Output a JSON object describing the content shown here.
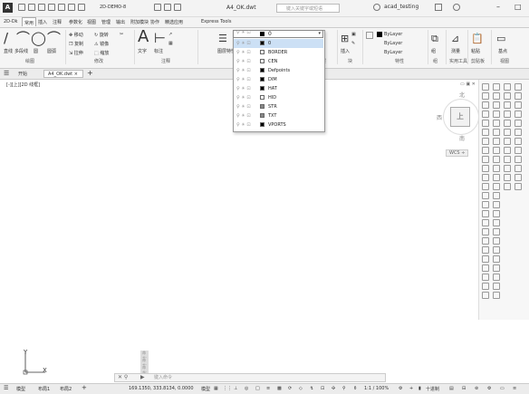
{
  "titlebar": {
    "logo": "A",
    "workspace": "2D-DEMO-8",
    "doc_title": "A4_OK.dwt",
    "search_placeholder": "键入关键字或短语",
    "user": "acad_testing",
    "min": "–",
    "close": "□"
  },
  "ribbon_tabs": [
    "2D-Dk",
    "常用",
    "插入",
    "注释",
    "参数化",
    "视图",
    "管理",
    "输出",
    "附加模块",
    "协作",
    "精选应用",
    "Express Tools"
  ],
  "ribbon": {
    "groups": [
      "绘图",
      "修改",
      "注释",
      "图层",
      "块",
      "特性",
      "组",
      "实用工具",
      "剪贴板",
      "视图"
    ],
    "draw": {
      "line": "直线",
      "polyline": "多段线",
      "circle": "圆",
      "arc": "圆弧"
    },
    "modify": {
      "move": "移动",
      "rotate": "旋转",
      "copy": "复制",
      "mirror": "镜像",
      "stretch": "拉伸",
      "scale": "缩放"
    },
    "annotation": {
      "text": "文字",
      "dim": "标注"
    },
    "layer_props": "图层特性",
    "insert": "插入",
    "properties": {
      "bylayer1": "ByLayer",
      "bylayer2": "ByLayer",
      "bylayer3": "ByLayer",
      "match": "特性匹配"
    },
    "group": "组",
    "measure": "测量",
    "paste": "粘贴",
    "base": "基点"
  },
  "layer_dropdown": {
    "current": "0",
    "rows": [
      {
        "name": "0",
        "color": "#000000"
      },
      {
        "name": "BORDER",
        "color": "#ffffff"
      },
      {
        "name": "CEN",
        "color": "#ffffff"
      },
      {
        "name": "Defpoints",
        "color": "#000000"
      },
      {
        "name": "DIM",
        "color": "#000000"
      },
      {
        "name": "HAT",
        "color": "#000000"
      },
      {
        "name": "HID",
        "color": "#ffffff"
      },
      {
        "name": "STR",
        "color": "#888888"
      },
      {
        "name": "TXT",
        "color": "#888888"
      },
      {
        "name": "VPORTS",
        "color": "#000000"
      }
    ]
  },
  "doc_tabs": {
    "start": "开始",
    "doc": "A4_OK.dwt",
    "close": "×",
    "plus": "+"
  },
  "viewport": {
    "label": "[-][上][2D 线框]",
    "viewcube": {
      "north": "北",
      "south": "南",
      "east": "东",
      "west": "西",
      "face": "上"
    },
    "wcs": "WCS ÷",
    "ucs_x": "X",
    "ucs_y": "Y"
  },
  "command": {
    "history": [
      "命令:",
      "命令:",
      "命令:"
    ],
    "placeholder": "键入命令"
  },
  "statusbar": {
    "model": "模型",
    "layout1": "布局1",
    "layout2": "布局2",
    "coords": "169.1350, 333.8134, 0.0000",
    "model_space": "模型",
    "scale": "1:1 / 100%",
    "decimal": "十进制"
  }
}
